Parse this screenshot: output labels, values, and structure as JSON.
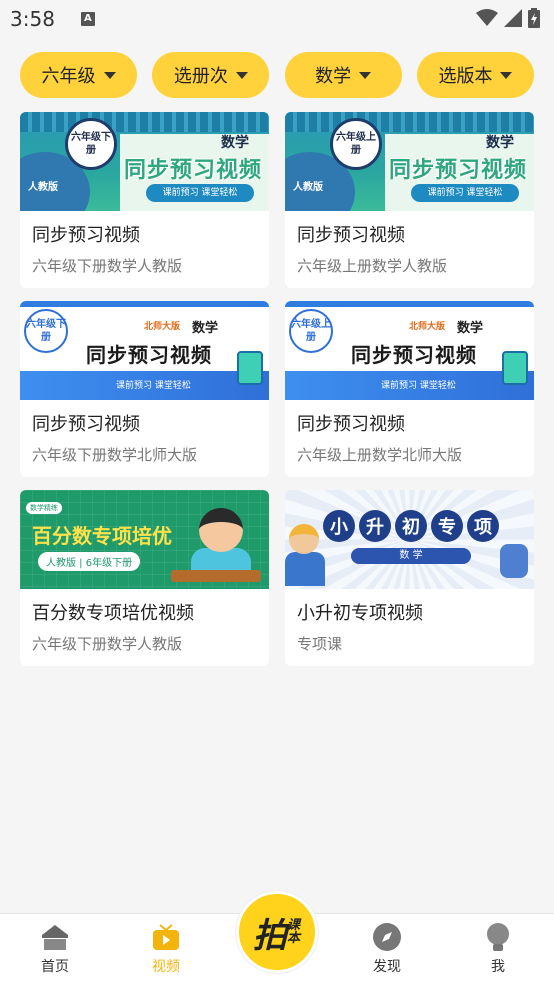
{
  "status_bar": {
    "time": "3:58",
    "notification_icon": "a-icon",
    "icons": [
      "wifi-icon",
      "signal-icon",
      "battery-icon"
    ]
  },
  "filters": [
    {
      "label": "六年级"
    },
    {
      "label": "选册次"
    },
    {
      "label": "数学"
    },
    {
      "label": "选版本"
    }
  ],
  "cards": [
    {
      "title": "同步预习视频",
      "subtitle": "六年级下册数学人教版",
      "thumb": {
        "grade": "六年级下册",
        "subject": "数学",
        "headline": "同步预习视频",
        "tagline": "课前预习 课堂轻松",
        "edition": "人教版"
      }
    },
    {
      "title": "同步预习视频",
      "subtitle": "六年级上册数学人教版",
      "thumb": {
        "grade": "六年级上册",
        "subject": "数学",
        "headline": "同步预习视频",
        "tagline": "课前预习 课堂轻松",
        "edition": "人教版"
      }
    },
    {
      "title": "同步预习视频",
      "subtitle": "六年级下册数学北师大版",
      "thumb": {
        "grade": "六年级下册",
        "publisher": "北师大版",
        "subject": "数学",
        "headline": "同步预习视频",
        "tagline": "课前预习 课堂轻松"
      }
    },
    {
      "title": "同步预习视频",
      "subtitle": "六年级上册数学北师大版",
      "thumb": {
        "grade": "六年级上册",
        "publisher": "北师大版",
        "subject": "数学",
        "headline": "同步预习视频",
        "tagline": "课前预习 课堂轻松"
      }
    },
    {
      "title": "百分数专项培优视频",
      "subtitle": "六年级下册数学人教版",
      "thumb": {
        "chip": "数学精练",
        "headline": "百分数专项培优",
        "label": "人教版 | 6年级下册"
      }
    },
    {
      "title": "小升初专项视频",
      "subtitle": "专项课",
      "thumb": {
        "chars": [
          "小",
          "升",
          "初",
          "专",
          "项"
        ],
        "bar": "数 学"
      }
    }
  ],
  "bottom_nav": {
    "items": [
      {
        "label": "首页",
        "icon": "home-icon",
        "active": false
      },
      {
        "label": "视频",
        "icon": "tv-icon",
        "active": true
      },
      {
        "label": "发现",
        "icon": "compass-icon",
        "active": false
      },
      {
        "label": "我",
        "icon": "profile-icon",
        "active": false
      }
    ],
    "camera": {
      "big": "拍",
      "small": "课本"
    }
  },
  "colors": {
    "accent": "#ffd23c",
    "active_nav": "#f2b40d",
    "background": "#f5f5f5"
  }
}
